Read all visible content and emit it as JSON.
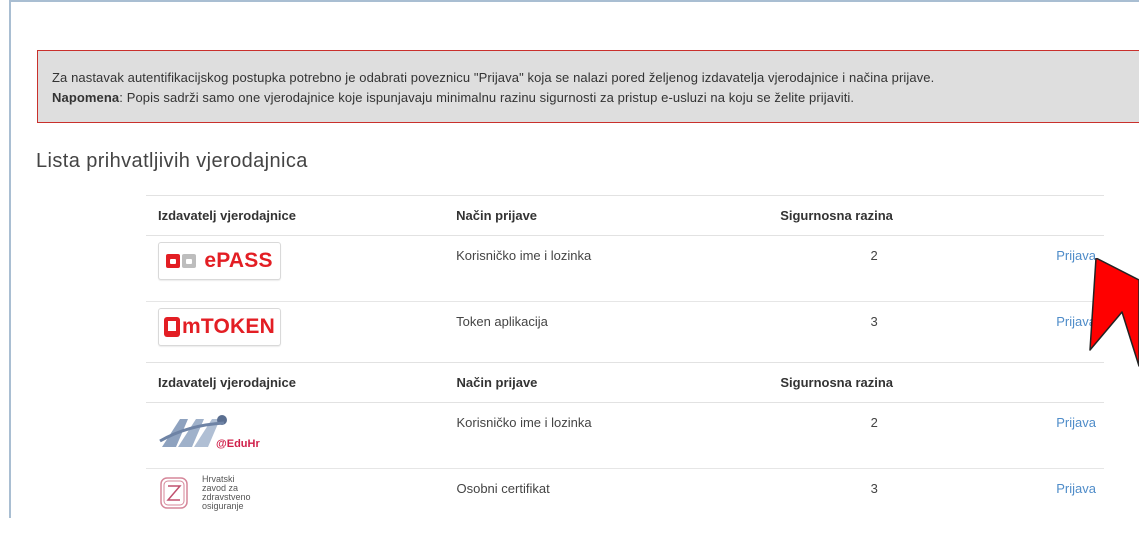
{
  "alert": {
    "line1": "Za nastavak autentifikacijskog postupka potrebno je odabrati poveznicu \"Prijava\" koja se nalazi pored željenog izdavatelja vjerodajnice i načina prijave.",
    "note_label": "Napomena",
    "line2": ": Popis sadrži samo one vjerodajnice koje ispunjavaju minimalnu razinu sigurnosti za pristup e-usluzi na koju se želite prijaviti."
  },
  "list_title": "Lista prihvatljivih vjerodajnica",
  "headers": {
    "issuer": "Izdavatelj vjerodajnice",
    "method": "Način prijave",
    "level": "Sigurnosna razina"
  },
  "table1": [
    {
      "issuer_logo": "ePASS",
      "method": "Korisničko ime i lozinka",
      "level": "2",
      "action": "Prijava"
    },
    {
      "issuer_logo": "mTOKEN",
      "method": "Token aplikacija",
      "level": "3",
      "action": "Prijava"
    }
  ],
  "table2": [
    {
      "issuer_logo": "@EduHr",
      "method": "Korisničko ime i lozinka",
      "level": "2",
      "action": "Prijava"
    },
    {
      "issuer_logo_lines": [
        "Hrvatski",
        "zavod za",
        "zdravstveno",
        "osiguranje"
      ],
      "method": "Osobni certifikat",
      "level": "3",
      "action": "Prijava"
    }
  ],
  "colors": {
    "alert_bg": "#dedede",
    "alert_border": "#c9302c",
    "link": "#4f8cc9",
    "arrow": "#ff0000"
  }
}
